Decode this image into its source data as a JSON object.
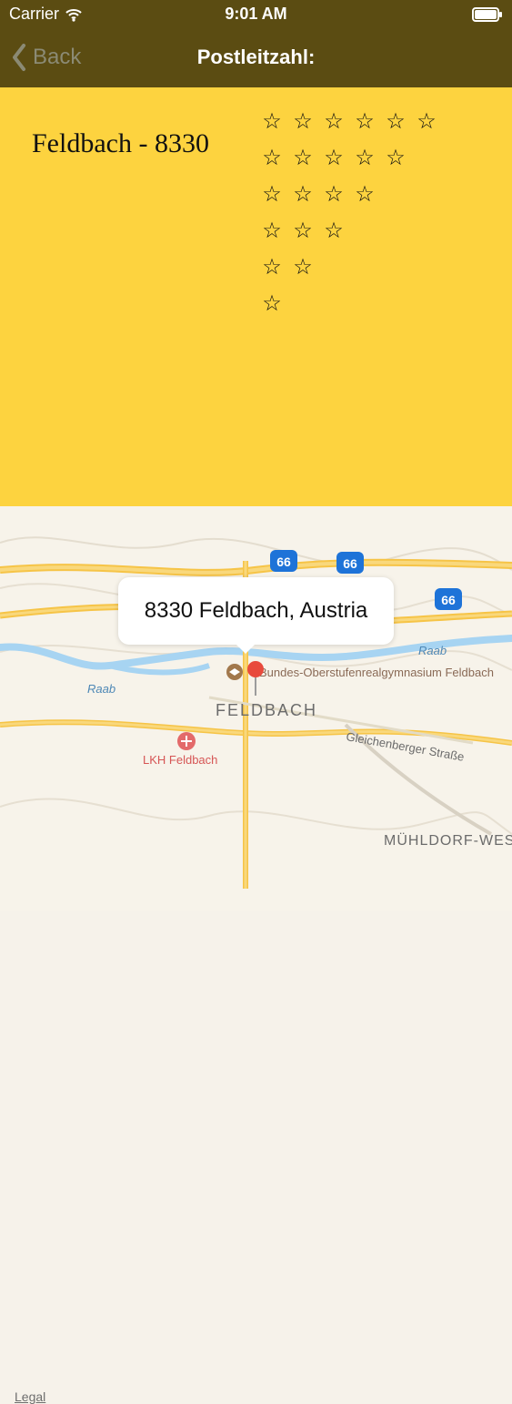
{
  "status_bar": {
    "carrier": "Carrier",
    "time": "9:01 AM"
  },
  "nav": {
    "back_label": "Back",
    "title": "Postleitzahl:"
  },
  "main": {
    "place_label": "Feldbach - 8330",
    "stars_rows": [
      6,
      5,
      4,
      3,
      2,
      1
    ],
    "star_char": "☆"
  },
  "map": {
    "callout_text": "8330 Feldbach, Austria",
    "labels": {
      "hwy1": "66",
      "hwy2": "66",
      "hwy3": "66",
      "river1": "Raab",
      "river2": "Raab",
      "school": "Bundes-Oberstufenrealgymnasium Feldbach",
      "town": "FELDBACH",
      "street": "Gleichenberger Straße",
      "hospital": "LKH Feldbach",
      "district": "MÜHLDORF-WEST"
    },
    "legal": "Legal"
  },
  "colors": {
    "nav_bg": "#5b4c12",
    "content_bg": "#fdd33f",
    "hwy_shield": "#1e73d8",
    "river": "#a7d4f2",
    "pin": "#e84a3c"
  }
}
